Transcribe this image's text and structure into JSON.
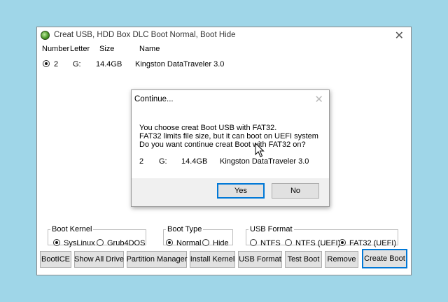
{
  "window": {
    "title": "Creat USB, HDD Box DLC Boot Normal, Boot Hide",
    "close_glyph": "✕"
  },
  "columns": [
    "Number",
    "Letter",
    "Size",
    "Name"
  ],
  "drive": {
    "number": "2",
    "letter": "G:",
    "size": "14.4GB",
    "name": "Kingston DataTraveler 3.0",
    "selected": true
  },
  "boot_kernel": {
    "label": "Boot Kernel",
    "options": [
      {
        "label": "SysLinux",
        "selected": true
      },
      {
        "label": "Grub4DOS",
        "selected": false
      }
    ]
  },
  "boot_type": {
    "label": "Boot Type",
    "options": [
      {
        "label": "Normal",
        "selected": true
      },
      {
        "label": "Hide",
        "selected": false
      }
    ]
  },
  "usb_format": {
    "label": "USB Format",
    "options": [
      {
        "label": "NTFS",
        "selected": false
      },
      {
        "label": "NTFS (UEFI)",
        "selected": false
      },
      {
        "label": "FAT32 (UEFI)",
        "selected": true
      }
    ]
  },
  "buttons": [
    "BootICE",
    "Show All Drive",
    "Partition Manager",
    "Install Kernel",
    "USB Format",
    "Test Boot",
    "Remove",
    "Create Boot"
  ],
  "dialog": {
    "title": "Continue...",
    "close_glyph": "✕",
    "lines": [
      "You choose creat Boot USB with FAT32.",
      "FAT32 limits file size, but it can boot on UEFI system",
      "Do you want continue creat Boot with FAT32 on?"
    ],
    "drive_number": "2",
    "drive_letter": "G:",
    "drive_size": "14.4GB",
    "drive_name": "Kingston DataTraveler 3.0",
    "yes_label": "Yes",
    "no_label": "No"
  },
  "colors": {
    "desktop": "#9fd6e8",
    "default_button_border": "#0078d7"
  }
}
